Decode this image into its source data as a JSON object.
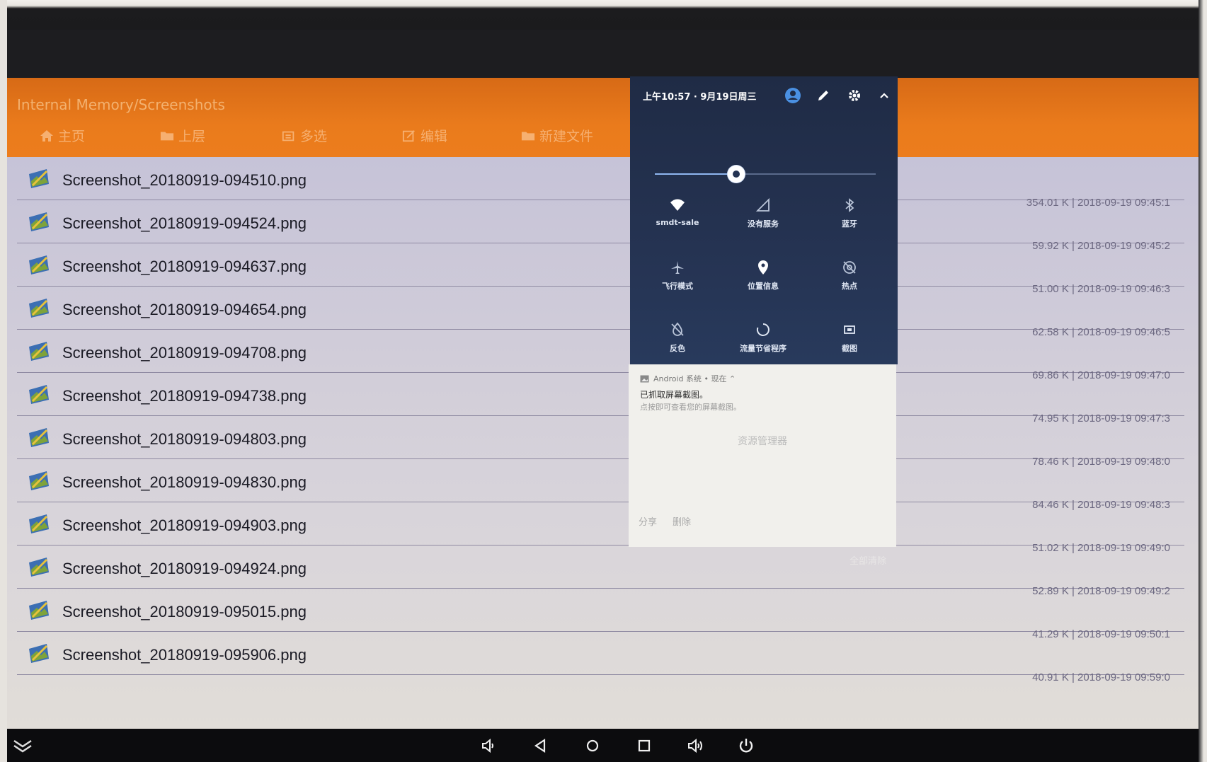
{
  "header": {
    "path": "Internal Memory/Screenshots",
    "toolbar": [
      {
        "label": "主页",
        "icon": "home-icon"
      },
      {
        "label": "上层",
        "icon": "folder-up-icon"
      },
      {
        "label": "多选",
        "icon": "multiselect-icon"
      },
      {
        "label": "编辑",
        "icon": "edit-icon"
      },
      {
        "label": "新建文件",
        "icon": "new-folder-icon"
      }
    ]
  },
  "files": [
    {
      "name": "Screenshot_20180919-094510.png",
      "meta": "354.01 K | 2018-09-19 09:45:1"
    },
    {
      "name": "Screenshot_20180919-094524.png",
      "meta": "59.92 K | 2018-09-19 09:45:2"
    },
    {
      "name": "Screenshot_20180919-094637.png",
      "meta": "51.00 K | 2018-09-19 09:46:3"
    },
    {
      "name": "Screenshot_20180919-094654.png",
      "meta": "62.58 K | 2018-09-19 09:46:5"
    },
    {
      "name": "Screenshot_20180919-094708.png",
      "meta": "69.86 K | 2018-09-19 09:47:0"
    },
    {
      "name": "Screenshot_20180919-094738.png",
      "meta": "74.95 K | 2018-09-19 09:47:3"
    },
    {
      "name": "Screenshot_20180919-094803.png",
      "meta": "78.46 K | 2018-09-19 09:48:0"
    },
    {
      "name": "Screenshot_20180919-094830.png",
      "meta": "84.46 K | 2018-09-19 09:48:3"
    },
    {
      "name": "Screenshot_20180919-094903.png",
      "meta": "51.02 K | 2018-09-19 09:49:0"
    },
    {
      "name": "Screenshot_20180919-094924.png",
      "meta": "52.89 K | 2018-09-19 09:49:2"
    },
    {
      "name": "Screenshot_20180919-095015.png",
      "meta": "41.29 K | 2018-09-19 09:50:1"
    },
    {
      "name": "Screenshot_20180919-095906.png",
      "meta": "40.91 K | 2018-09-19 09:59:0"
    }
  ],
  "quick_settings": {
    "datetime": "上午10:57 · 9月19日周三",
    "brightness_level": 0.37,
    "tiles": [
      {
        "label": "smdt-sale",
        "icon": "wifi-icon",
        "active": true
      },
      {
        "label": "没有服务",
        "icon": "cellular-icon",
        "active": false
      },
      {
        "label": "蓝牙",
        "icon": "bluetooth-icon",
        "active": false
      },
      {
        "label": "飞行模式",
        "icon": "airplane-icon",
        "active": false
      },
      {
        "label": "位置信息",
        "icon": "location-icon",
        "active": true
      },
      {
        "label": "热点",
        "icon": "hotspot-icon",
        "active": false
      },
      {
        "label": "反色",
        "icon": "invert-colors-icon",
        "active": false
      },
      {
        "label": "流量节省程序",
        "icon": "data-saver-icon",
        "active": false
      },
      {
        "label": "截图",
        "icon": "screenshot-icon",
        "active": false
      }
    ]
  },
  "notification": {
    "source": "Android 系统 • 现在 ⌃",
    "title": "已抓取屏幕截图。",
    "subtitle": "点按即可查看您的屏幕截图。",
    "action_main": "资源管理器",
    "action_share": "分享",
    "action_delete": "删除",
    "clear_all": "全部清除"
  },
  "colors": {
    "header_orange": "#ea7b1c",
    "qs_background": "#253352",
    "accent_blue": "#4a90e2"
  }
}
